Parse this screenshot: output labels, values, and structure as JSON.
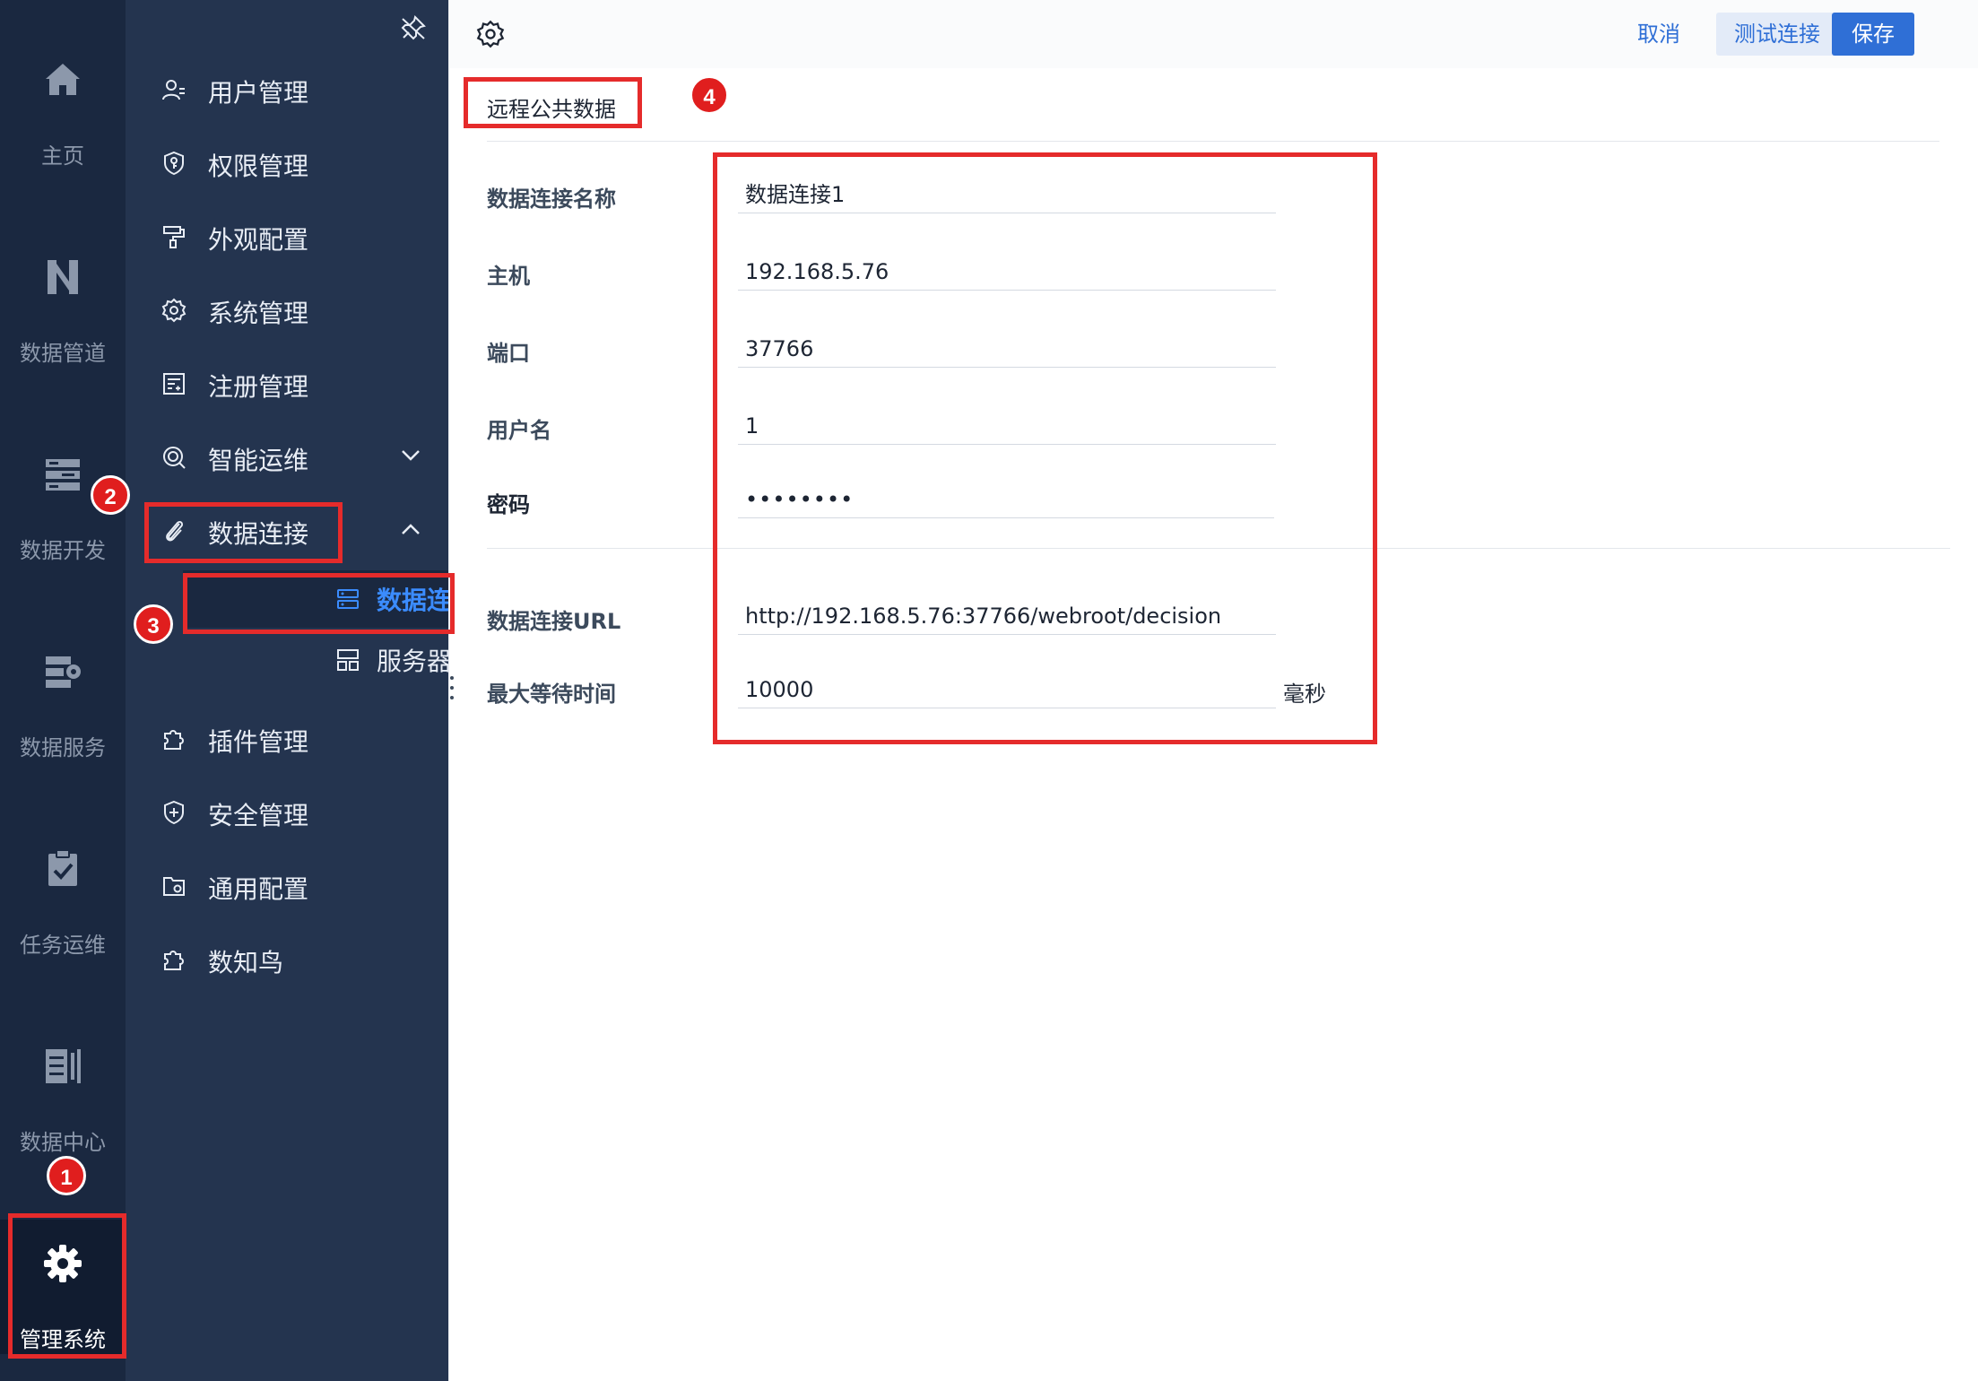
{
  "rail": {
    "items": [
      {
        "label": "主页",
        "icon": "home-icon"
      },
      {
        "label": "数据管道",
        "icon": "pipeline-icon"
      },
      {
        "label": "数据开发",
        "icon": "data-dev-icon"
      },
      {
        "label": "数据服务",
        "icon": "data-service-icon"
      },
      {
        "label": "任务运维",
        "icon": "task-check-icon"
      },
      {
        "label": "数据中心",
        "icon": "data-center-icon"
      },
      {
        "label": "管理系统",
        "icon": "gear-icon"
      }
    ]
  },
  "submenu": {
    "pin_icon": "pin-icon",
    "items": [
      {
        "label": "用户管理",
        "icon": "user-icon"
      },
      {
        "label": "权限管理",
        "icon": "shield-key-icon"
      },
      {
        "label": "外观配置",
        "icon": "paint-roller-icon"
      },
      {
        "label": "系统管理",
        "icon": "gear-icon"
      },
      {
        "label": "注册管理",
        "icon": "register-icon"
      },
      {
        "label": "智能运维",
        "icon": "smart-ops-icon"
      },
      {
        "label": "数据连接",
        "icon": "paperclip-icon"
      },
      {
        "label": "插件管理",
        "icon": "puzzle-icon"
      },
      {
        "label": "安全管理",
        "icon": "shield-plus-icon"
      },
      {
        "label": "通用配置",
        "icon": "folder-gear-icon"
      },
      {
        "label": "数知鸟",
        "icon": "puzzle-icon"
      }
    ],
    "sub_items": [
      {
        "label": "数据连接管理",
        "icon": "server-icon"
      },
      {
        "label": "服务器数据集",
        "icon": "dataset-icon"
      }
    ]
  },
  "topbar": {
    "settings_icon": "gear-icon",
    "cancel": "取消",
    "test": "测试连接",
    "save": "保存"
  },
  "tab": {
    "label": "远程公共数据"
  },
  "form": {
    "fields": [
      {
        "label": "数据连接名称",
        "value": "数据连接1"
      },
      {
        "label": "主机",
        "value": "192.168.5.76"
      },
      {
        "label": "端口",
        "value": "37766"
      },
      {
        "label": "用户名",
        "value": "1"
      },
      {
        "label": "密码",
        "value": "••••••••"
      }
    ],
    "url_label": "数据连接URL",
    "url_value": "http://192.168.5.76:37766/webroot/decision",
    "timeout_label": "最大等待时间",
    "timeout_value": "10000",
    "timeout_unit": "毫秒"
  },
  "badges": [
    "1",
    "2",
    "3",
    "4"
  ],
  "colors": {
    "rail_bg": "#1a2840",
    "submenu_bg": "#24344f",
    "accent": "#2f6fd6",
    "annotation": "#e52b2b"
  }
}
